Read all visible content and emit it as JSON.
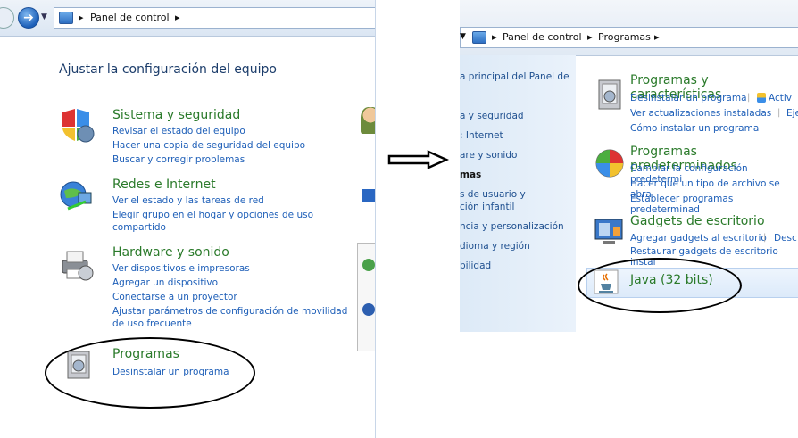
{
  "left": {
    "breadcrumb": "Panel de control",
    "heading": "Ajustar la configuración del equipo",
    "categories": [
      {
        "title": "Sistema y seguridad",
        "links": [
          "Revisar el estado del equipo",
          "Hacer una copia de seguridad del equipo",
          "Buscar y corregir problemas"
        ]
      },
      {
        "title": "Redes e Internet",
        "links": [
          "Ver el estado y las tareas de red",
          "Elegir grupo en el hogar y opciones de uso",
          "compartido"
        ]
      },
      {
        "title": "Hardware y sonido",
        "links": [
          "Ver dispositivos e impresoras",
          "Agregar un dispositivo",
          "Conectarse a un proyector",
          "Ajustar parámetros de configuración de movilidad",
          "de uso frecuente"
        ]
      },
      {
        "title": "Programas",
        "links": [
          "Desinstalar un programa"
        ]
      }
    ]
  },
  "right": {
    "breadcrumb": [
      "Panel de control",
      "Programas"
    ],
    "sidebar": [
      "a principal del Panel de",
      "a y seguridad",
      ": Internet",
      "are y sonido",
      "mas",
      "s de usuario y",
      "ción infantil",
      "ncia y personalización",
      "dioma y región",
      "bilidad"
    ],
    "sections": [
      {
        "title": "Programas y características",
        "links": [
          "Desinstalar un programa",
          "Activ",
          "Ver actualizaciones instaladas",
          "Ejec",
          "Cómo instalar un programa"
        ]
      },
      {
        "title": "Programas predeterminados",
        "links": [
          "Cambiar la configuración predetermi",
          "Hacer que un tipo de archivo se abra",
          "Establecer programas predeterminad"
        ]
      },
      {
        "title": "Gadgets de escritorio",
        "links": [
          "Agregar gadgets al escritorio",
          "Desc",
          "Restaurar gadgets de escritorio instal"
        ]
      },
      {
        "title": "Java (32 bits)"
      }
    ]
  },
  "colors": {
    "link": "#1e5fb8",
    "category_title": "#2a7a2a",
    "heading": "#1c3d6b"
  }
}
